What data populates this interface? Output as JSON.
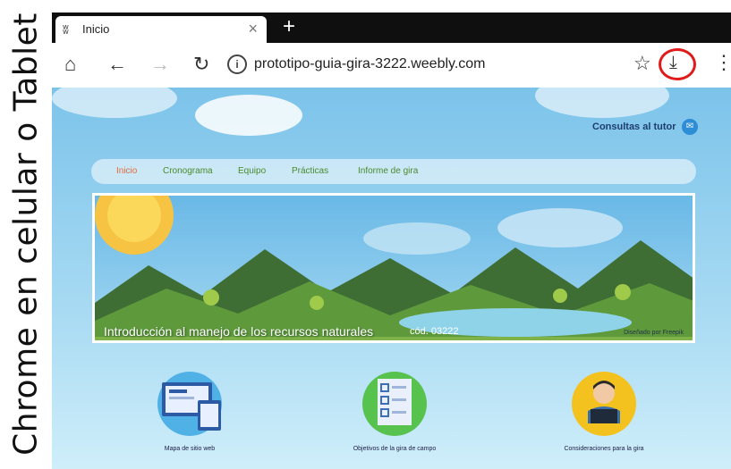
{
  "caption": "Chrome en celular o Tablet",
  "browser": {
    "tab": {
      "favicon": "weebly-w-icon",
      "title": "Inicio"
    },
    "url": "prototipo-guia-gira-3222.weebly.com"
  },
  "site": {
    "tutor_link": "Consultas al tutor",
    "nav": [
      "Inicio",
      "Cronograma",
      "Equipo",
      "Prácticas",
      "Informe de gira"
    ],
    "hero": {
      "title": "Introducción al manejo de los recursos naturales",
      "code": "cód. 03222",
      "credit": "Diseñado por Freepik"
    },
    "icons": [
      {
        "label": "Mapa de sitio web",
        "icon": "devices-icon"
      },
      {
        "label": "Objetivos de la gira de campo",
        "icon": "checklist-icon"
      },
      {
        "label": "Consideraciones para la gira",
        "icon": "reader-icon"
      }
    ]
  },
  "colors": {
    "download_highlight": "#e01b1b",
    "nav_active": "#e06b3a",
    "nav_link": "#4a8a2a"
  }
}
